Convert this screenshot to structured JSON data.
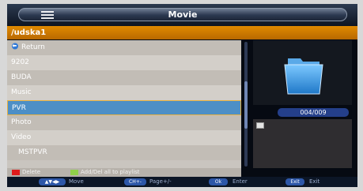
{
  "title": "Movie",
  "path": "/udska1",
  "list": [
    {
      "label": "Return",
      "icon": "return-icon"
    },
    {
      "label": "9202"
    },
    {
      "label": "BUDA"
    },
    {
      "label": "Music"
    },
    {
      "label": "PVR",
      "selected": true
    },
    {
      "label": "Photo"
    },
    {
      "label": "Video"
    },
    {
      "label": "MSTPVR"
    }
  ],
  "counter": "004/009",
  "legend": {
    "delete_label": "Delete",
    "playlist_label": "Add/Del all to playlist",
    "delete_color": "#e01b1b",
    "playlist_color": "#8fd04a"
  },
  "help": [
    {
      "key": "▲▼◀▶",
      "label": "Move"
    },
    {
      "key": "CH+-",
      "label": "Page+/-"
    },
    {
      "key": "Ok",
      "label": "Enter"
    },
    {
      "key": "Exit",
      "label": "Exit"
    }
  ],
  "colors": {
    "path_bar": "#d17d00",
    "selection": "#4d8fc6",
    "folder": "#3aa0e6"
  },
  "icons": {
    "menu": "menu-icon",
    "folder": "folder-icon",
    "info": "info-icon"
  }
}
